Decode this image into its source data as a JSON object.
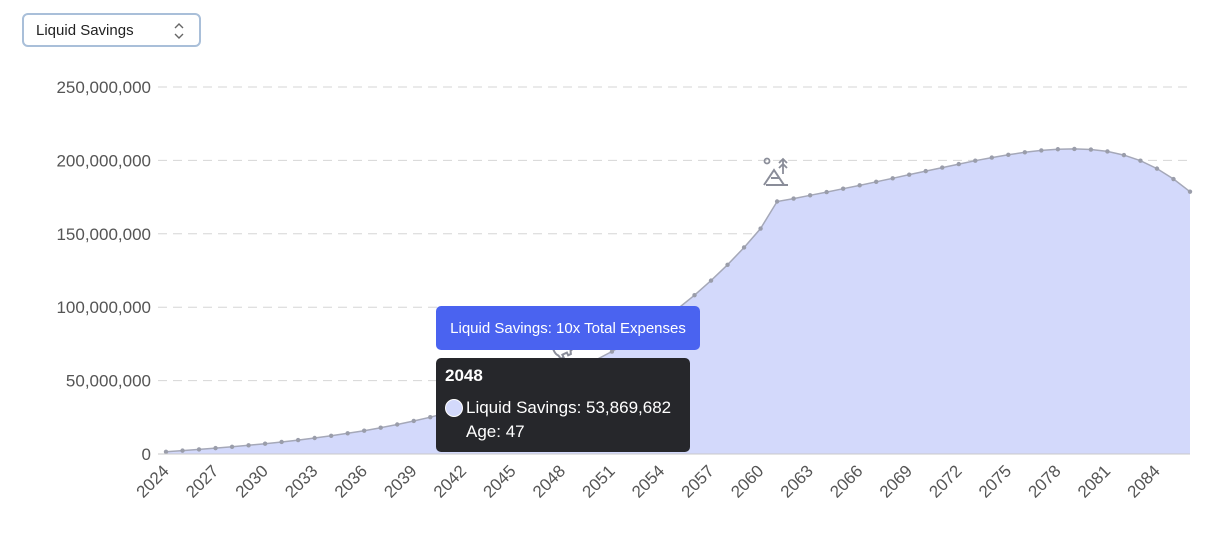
{
  "selector": {
    "value": "Liquid Savings",
    "icon": "chevron-up-down-icon"
  },
  "colors": {
    "area_fill": "#d3d9fb",
    "line": "#a5a8b8",
    "point": "#9a9daa",
    "banner": "#4a63f0",
    "tooltip_bg": "#26272b",
    "grid": "#d6d6d6"
  },
  "banner": {
    "text": "Liquid Savings: 10x Total Expenses"
  },
  "tooltip": {
    "title": "2048",
    "series_label": "Liquid Savings: 53,869,682",
    "age_label": "Age: 47"
  },
  "markers": [
    {
      "year": 2048,
      "icon": "piggy-bank-icon"
    },
    {
      "year": 2061,
      "icon": "retirement-beach-icon"
    }
  ],
  "chart_data": {
    "type": "area",
    "title": "",
    "xlabel": "",
    "ylabel": "",
    "ylim": [
      0,
      250000000
    ],
    "y_ticks": [
      "0",
      "50,000,000",
      "100,000,000",
      "150,000,000",
      "200,000,000",
      "250,000,000"
    ],
    "x_tick_labels": [
      "2024",
      "2027",
      "2030",
      "2033",
      "2036",
      "2039",
      "2042",
      "2045",
      "2048",
      "2051",
      "2054",
      "2057",
      "2060",
      "2063",
      "2066",
      "2069",
      "2072",
      "2075",
      "2078",
      "2081",
      "2084"
    ],
    "grid": true,
    "highlight_year": 2048,
    "series": [
      {
        "name": "Liquid Savings",
        "x": [
          2024,
          2025,
          2026,
          2027,
          2028,
          2029,
          2030,
          2031,
          2032,
          2033,
          2034,
          2035,
          2036,
          2037,
          2038,
          2039,
          2040,
          2041,
          2042,
          2043,
          2044,
          2045,
          2046,
          2047,
          2048,
          2049,
          2050,
          2051,
          2052,
          2053,
          2054,
          2055,
          2056,
          2057,
          2058,
          2059,
          2060,
          2061,
          2062,
          2063,
          2064,
          2065,
          2066,
          2067,
          2068,
          2069,
          2070,
          2071,
          2072,
          2073,
          2074,
          2075,
          2076,
          2077,
          2078,
          2079,
          2080,
          2081,
          2082,
          2083,
          2084,
          2085,
          2086
        ],
        "values": [
          1500000,
          2300000,
          3100000,
          4000000,
          4900000,
          5900000,
          7000000,
          8200000,
          9500000,
          10900000,
          12400000,
          14100000,
          15900000,
          17900000,
          20100000,
          22500000,
          25100000,
          28000000,
          31200000,
          34700000,
          38500000,
          42600000,
          47100000,
          52000000,
          53869682,
          58500000,
          63900000,
          69800000,
          76200000,
          83200000,
          90800000,
          99100000,
          108200000,
          118100000,
          128900000,
          140700000,
          153600000,
          172000000,
          174000000,
          176200000,
          178400000,
          180700000,
          183000000,
          185400000,
          187800000,
          190300000,
          192700000,
          195100000,
          197500000,
          199800000,
          201900000,
          203800000,
          205500000,
          206800000,
          207600000,
          207800000,
          207400000,
          206100000,
          203600000,
          199800000,
          194400000,
          187300000,
          178700000
        ]
      }
    ]
  }
}
